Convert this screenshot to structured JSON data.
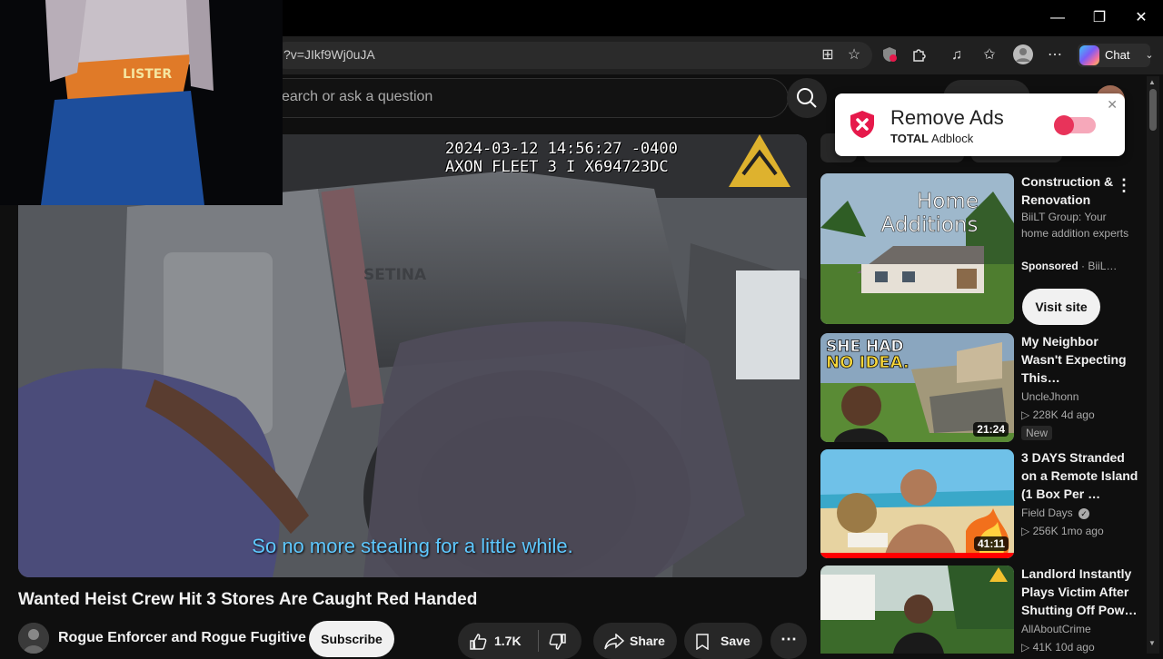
{
  "browser": {
    "url": "?v=JIkf9Wj0uJA",
    "chat_label": "Chat",
    "window_controls": [
      "minimize",
      "restore",
      "close"
    ]
  },
  "youtube": {
    "search_placeholder": "earch or ask a question"
  },
  "video": {
    "overlay_timestamp": "2024-03-12 14:56:27 -0400",
    "overlay_device": "AXON FLEET 3 I X694723DC",
    "subtitle": "So no more stealing for a little while.",
    "seat_text": "SETINA",
    "title": "Wanted Heist Crew Hit 3 Stores Are Caught Red Handed",
    "channel": "Rogue Enforcer and Rogue Fugitive",
    "subscribe_label": "Subscribe",
    "likes": "1.7K",
    "share_label": "Share",
    "save_label": "Save",
    "webcam_text": "LISTER"
  },
  "ad_popup": {
    "title": "Remove Ads",
    "brand_bold": "TOTAL",
    "brand_rest": " Adblock",
    "toggle_on": true
  },
  "sponsored": {
    "thumb_text_1": "Home",
    "thumb_text_2": "Additions",
    "title": "Construction & Renovation",
    "description": "BiiLT Group: Your home addition experts",
    "sponsored_label": "Sponsored",
    "advertiser": "BiiL…",
    "visit_label": "Visit site"
  },
  "recommendations": [
    {
      "title": "My Neighbor Wasn't Expecting This…",
      "channel": "UncleJhonn",
      "meta": "228K  4d ago",
      "badge": "New",
      "duration": "21:24",
      "thumb_text_1": "SHE HAD",
      "thumb_text_2": "NO IDEA."
    },
    {
      "title": "3 DAYS Stranded on a Remote Island (1 Box Per …",
      "channel": "Field Days",
      "meta": "256K  1mo ago",
      "duration": "41:11",
      "verified": true
    },
    {
      "title": "Landlord Instantly Plays Victim After Shutting Off Pow…",
      "channel": "AllAboutCrime",
      "meta": "41K  10d ago"
    }
  ],
  "colors": {
    "accent_red": "#ff0000",
    "popup_red": "#e6194b",
    "toggle_red": "#e8335a"
  }
}
